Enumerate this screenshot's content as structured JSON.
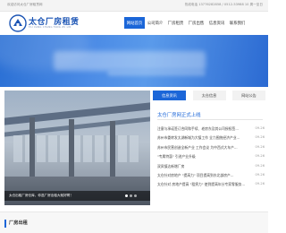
{
  "topbar": {
    "welcome": "欢迎访问太仓厂房租赁网",
    "contact": "热线电话 13776282858 / 0512-53988 10  周一至日"
  },
  "header": {
    "logo_name": "太仓厂房租赁",
    "logo_sub": "TAI CANG CHANG FANG ZU LIN"
  },
  "nav": [
    {
      "label": "网站首页",
      "active": true
    },
    {
      "label": "公司简介",
      "active": false
    },
    {
      "label": "厂房租赁",
      "active": false
    },
    {
      "label": "厂房出售",
      "active": false
    },
    {
      "label": "信息资讯",
      "active": false
    },
    {
      "label": "联系我们",
      "active": false
    }
  ],
  "slider": {
    "caption": "太仓出租厂房仓库，你选厂房出租大就好啊！",
    "dots": 3,
    "active_dot": 0
  },
  "news_tabs": [
    {
      "label": "信息资讯",
      "active": true
    },
    {
      "label": "太仓信息",
      "active": false
    },
    {
      "label": "网站公告",
      "active": false
    }
  ],
  "news": {
    "feature_title": "太仓厂房网正式上线",
    "items": [
      {
        "title": "注意与承诺签订合同和手续、老房东及其公司授权签...",
        "date": "09-26"
      },
      {
        "title": "苏州市委转发太湖新城为大镇工作 全力围绕经济产业...",
        "date": "09-26"
      },
      {
        "title": "苏州市民营创造全新产业 工作会议 为中西式大车产...",
        "date": "09-26"
      },
      {
        "title": "\"专属特惠\" 引进产业升级",
        "date": "09-26"
      },
      {
        "title": "双凤镇达新增厂房",
        "date": "09-26"
      },
      {
        "title": "太仓针对房地产 \"提高力\" 项目提高到东北部房产...",
        "date": "09-26"
      },
      {
        "title": "太仓针对 房地产提高 \"租赁力\" 使到提高年分专家零服务...",
        "date": "09-26"
      }
    ]
  },
  "section": {
    "title": "厂房出租"
  }
}
